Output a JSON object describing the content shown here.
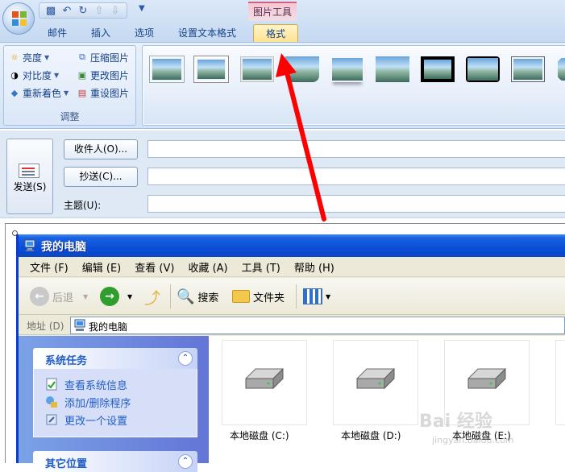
{
  "ribbon": {
    "context_tab": "图片工具",
    "tabs": [
      {
        "label": "邮件"
      },
      {
        "label": "插入"
      },
      {
        "label": "选项"
      },
      {
        "label": "设置文本格式"
      },
      {
        "label": "格式",
        "active": true
      }
    ],
    "adjust_group": {
      "label": "调整",
      "items": [
        {
          "label": "亮度",
          "icon": "brightness-icon"
        },
        {
          "label": "对比度",
          "icon": "contrast-icon"
        },
        {
          "label": "重新着色",
          "icon": "recolor-icon"
        },
        {
          "label": "压缩图片",
          "icon": "compress-picture-icon"
        },
        {
          "label": "更改图片",
          "icon": "change-picture-icon"
        },
        {
          "label": "重设图片",
          "icon": "reset-picture-icon"
        }
      ]
    }
  },
  "compose": {
    "send_label": "发送(S)",
    "to_button": "收件人(O)...",
    "cc_button": "抄送(C)...",
    "subject_label": "主题(U):",
    "to_value": "",
    "cc_value": "",
    "subject_value": ""
  },
  "explorer": {
    "title": "我的电脑",
    "menu": [
      "文件 (F)",
      "编辑 (E)",
      "查看 (V)",
      "收藏 (A)",
      "工具 (T)",
      "帮助 (H)"
    ],
    "toolbar": {
      "back": "后退",
      "search": "搜索",
      "folders": "文件夹"
    },
    "address_label": "地址 (D)",
    "address_value": "我的电脑",
    "system_tasks": {
      "title": "系统任务",
      "items": [
        "查看系统信息",
        "添加/删除程序",
        "更改一个设置"
      ]
    },
    "other_places": {
      "title": "其它位置"
    },
    "drives": [
      {
        "label": "本地磁盘 (C:)"
      },
      {
        "label": "本地磁盘 (D:)"
      },
      {
        "label": "本地磁盘 (E:)"
      }
    ]
  },
  "watermark": {
    "text": "Bai 经验",
    "sub": "jingyan.baidu.com"
  },
  "colors": {
    "ribbon_blue": "#15428b",
    "active_tab": "#ffe08c",
    "xp_title": "#0a4ed7",
    "task_link": "#215dc6",
    "arrow": "#ff0000"
  }
}
